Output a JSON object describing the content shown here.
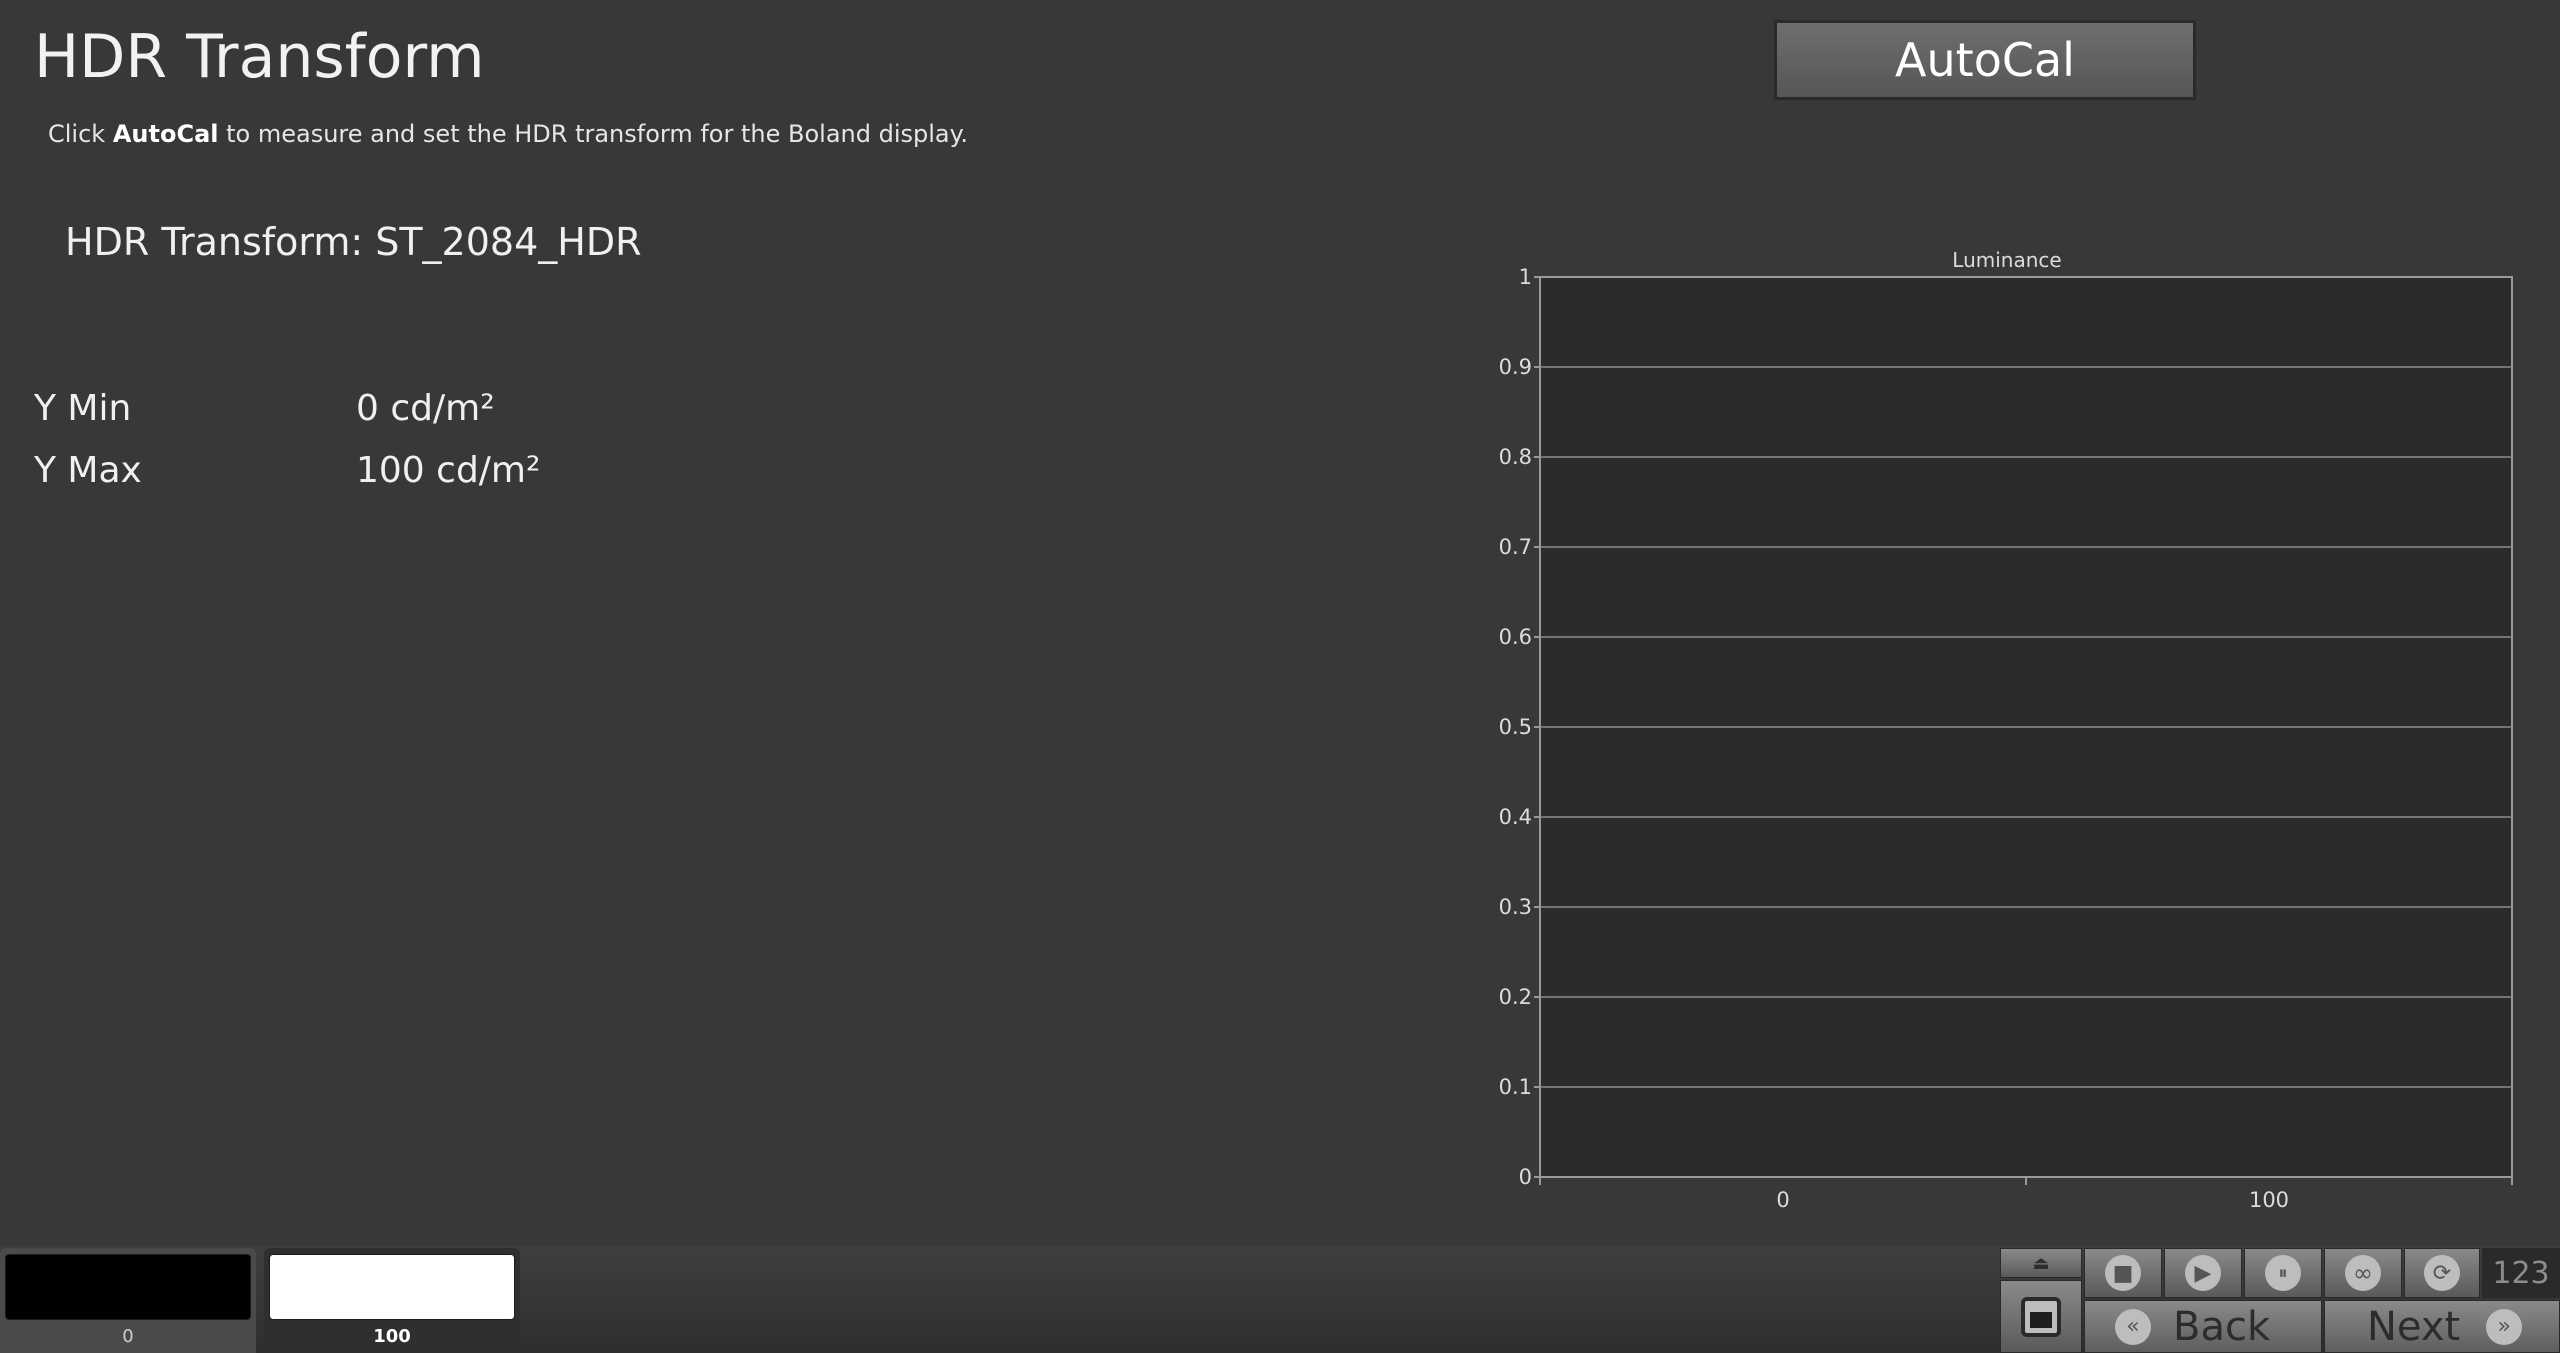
{
  "page": {
    "title": "HDR Transform",
    "description": {
      "prefix": "Click ",
      "bold": "AutoCal",
      "suffix": " to measure and set the HDR transform for the Boland display."
    },
    "transform_line": "HDR Transform: ST_2084_HDR",
    "measurements": [
      {
        "label": "Y Min",
        "value": "0 cd/m²"
      },
      {
        "label": "Y Max",
        "value": "100 cd/m²"
      }
    ]
  },
  "buttons": {
    "autocal": "AutoCal",
    "back": "Back",
    "next": "Next"
  },
  "chart_data": {
    "type": "line",
    "title": "Luminance",
    "xlabel": "",
    "ylabel": "",
    "x_tick_labels": [
      "0",
      "100"
    ],
    "y_ticks": [
      "0",
      "0.1",
      "0.2",
      "0.3",
      "0.4",
      "0.5",
      "0.6",
      "0.7",
      "0.8",
      "0.9",
      "1"
    ],
    "ylim": [
      0,
      1
    ],
    "grid": true,
    "series": []
  },
  "patches": [
    {
      "label": "0",
      "color": "#000000",
      "selected": false
    },
    {
      "label": "100",
      "color": "#ffffff",
      "selected": true
    }
  ],
  "controls": {
    "counter": "123",
    "icons": [
      "stop-icon",
      "play-icon",
      "pause-icon",
      "loop-icon",
      "refresh-icon"
    ]
  },
  "colors": {
    "background": "#383838",
    "plot_area": "#2b2b2b"
  }
}
